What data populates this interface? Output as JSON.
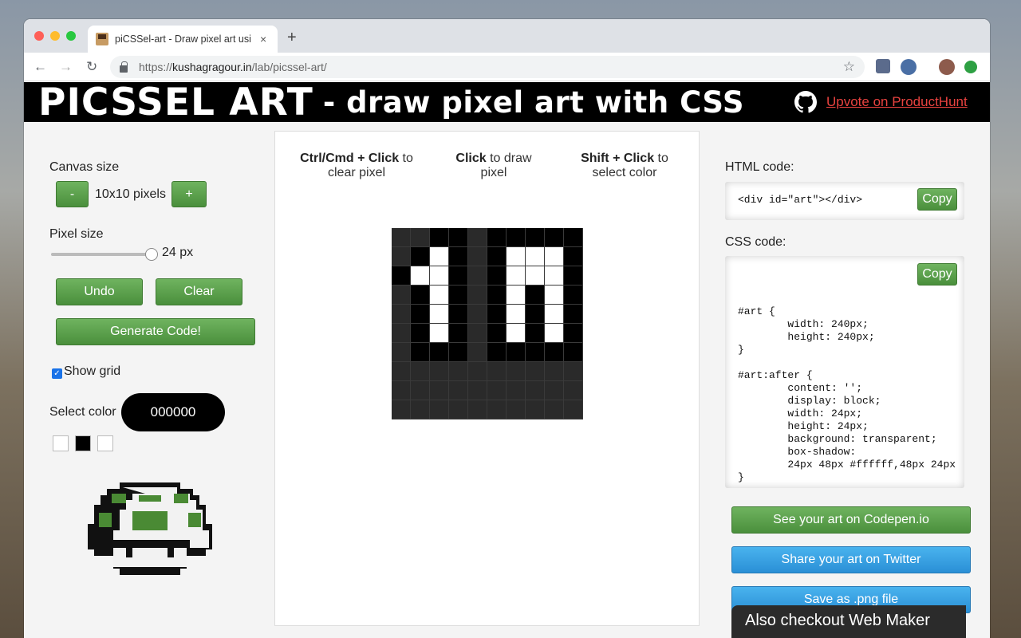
{
  "browser": {
    "tab_title": "piCSSel-art - Draw pixel art usi",
    "tab_close": "×",
    "new_tab": "+",
    "url_prefix": "https://",
    "url_host": "kushagragour.in",
    "url_path": "/lab/picssel-art/",
    "back": "←",
    "forward": "→",
    "reload": "↻",
    "star": "☆"
  },
  "banner": {
    "title": "PICSSEL ART",
    "subtitle": "- draw pixel art with CSS",
    "producthunt_link": "Upvote on ProductHunt"
  },
  "left": {
    "canvas_size_label": "Canvas size",
    "minus": "-",
    "canvas_size_value": "10x10 pixels",
    "plus": "+",
    "pixel_size_label": "Pixel size",
    "pixel_size_value": "24 px",
    "pixel_size_slider_fraction": 0.97,
    "undo": "Undo",
    "clear": "Clear",
    "generate": "Generate Code!",
    "show_grid_label": "Show grid",
    "show_grid_checked": true,
    "select_color_label": "Select color",
    "selected_color": "000000",
    "swatches": [
      "#ffffff",
      "#000000",
      "#ffffff"
    ]
  },
  "center": {
    "hint1_bold": "Ctrl/Cmd + Click",
    "hint1_rest": " to clear pixel",
    "hint2_bold": "Click",
    "hint2_rest": " to draw pixel",
    "hint3_bold": "Shift + Click",
    "hint3_rest": " to select color",
    "grid": [
      "EEBBEBBBBB",
      "EBWBEBWWWB",
      "BWWBEBWWWB",
      "EBWBEBWBWB",
      "EBWBEBWBWB",
      "EBWBEBWBWB",
      "EBBBEBBBBB",
      "EEEEEEEEEE",
      "EEEEEEEEEE",
      "EEEEEEEEEE"
    ]
  },
  "right": {
    "html_label": "HTML code:",
    "html_code": "<div id=\"art\"></div>",
    "css_label": "CSS code:",
    "css_code": "#art {\n        width: 240px;\n        height: 240px;\n}\n\n#art:after {\n        content: '';\n        display: block;\n        width: 24px;\n        height: 24px;\n        background: transparent;\n        box-shadow:\n        24px 48px #ffffff,48px 24px\n}",
    "copy": "Copy",
    "codepen": "See your art on Codepen.io",
    "twitter": "Share your art on Twitter",
    "png": "Save as .png file"
  },
  "footer": {
    "webmaker": "Also checkout Web Maker"
  },
  "colors": {
    "green": "#4a8f3c",
    "blue": "#2a8fd6",
    "empty_pixel": "#2a2a2a",
    "black_pixel": "#000000",
    "white_pixel": "#ffffff"
  }
}
